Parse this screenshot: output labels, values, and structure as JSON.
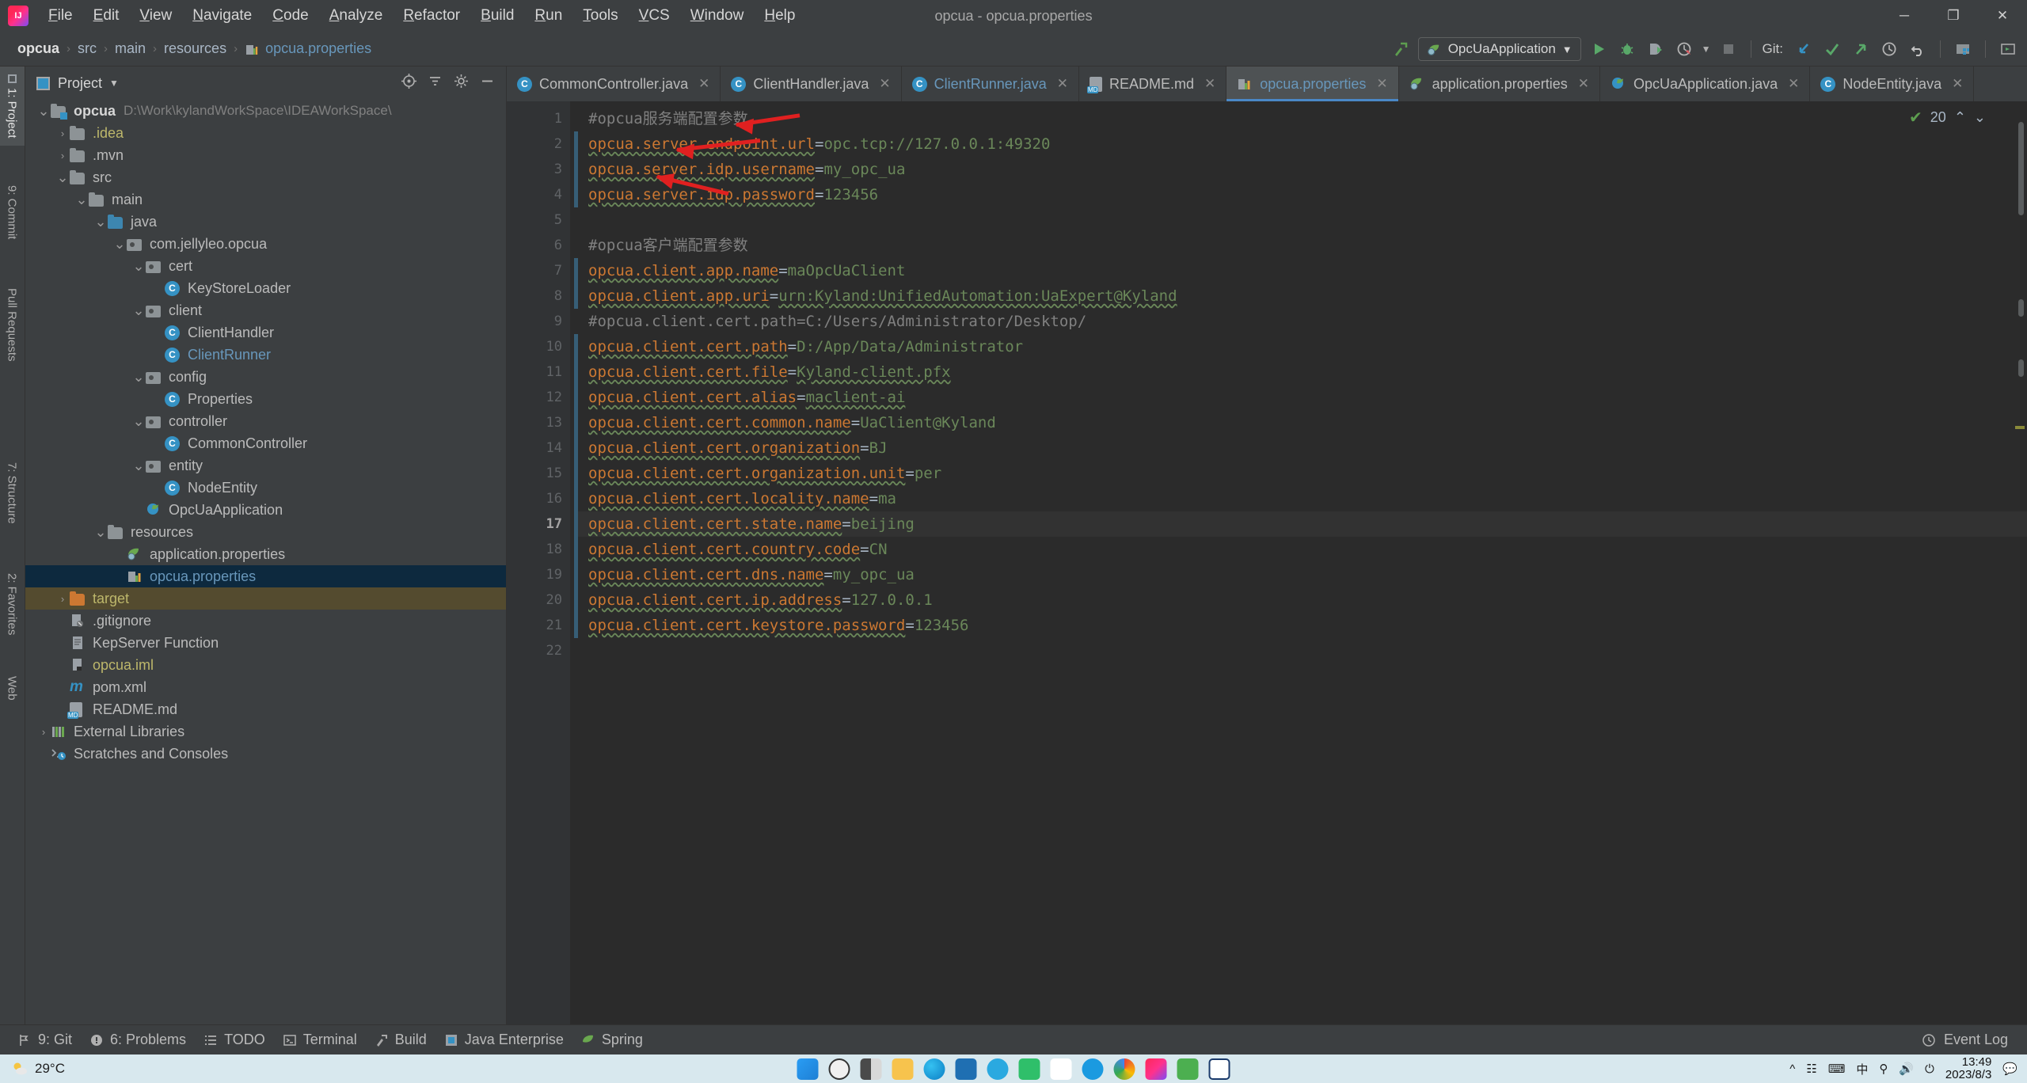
{
  "window": {
    "title": "opcua - opcua.properties",
    "minimize": "─",
    "maximize": "❐",
    "close": "✕"
  },
  "menu": [
    {
      "label": "File"
    },
    {
      "label": "Edit"
    },
    {
      "label": "View"
    },
    {
      "label": "Navigate"
    },
    {
      "label": "Code"
    },
    {
      "label": "Analyze"
    },
    {
      "label": "Refactor"
    },
    {
      "label": "Build"
    },
    {
      "label": "Run"
    },
    {
      "label": "Tools"
    },
    {
      "label": "VCS"
    },
    {
      "label": "Window"
    },
    {
      "label": "Help"
    }
  ],
  "breadcrumb": {
    "items": [
      "opcua",
      "src",
      "main",
      "resources",
      "opcua.properties"
    ],
    "separator": "›"
  },
  "toolbar": {
    "run_config": "OpcUaApplication",
    "git_label": "Git:",
    "icons": {
      "build": "hammer-icon",
      "run": "run-icon",
      "debug": "debug-icon",
      "coverage": "coverage-icon",
      "profile": "profiler-icon",
      "stop": "stop-icon",
      "update": "git-update-icon",
      "commit": "git-commit-icon",
      "push": "git-push-icon",
      "history": "history-icon",
      "rollback": "rollback-icon",
      "project-structure": "project-structure-icon",
      "search-everywhere": "terminal-icon"
    }
  },
  "left_strip": {
    "tabs": [
      {
        "label": "1: Project",
        "active": true
      },
      {
        "label": "9: Commit",
        "active": false
      },
      {
        "label": "Pull Requests",
        "active": false
      }
    ],
    "bottom_tabs": [
      {
        "label": "7: Structure"
      },
      {
        "label": "2: Favorites"
      },
      {
        "label": "Web"
      }
    ]
  },
  "project_panel": {
    "title": "Project",
    "chevron": "▾",
    "header_icons": [
      "target-icon",
      "collapse-icon",
      "settings-icon",
      "hide-icon"
    ],
    "tree": [
      {
        "indent": 0,
        "arrow": "down",
        "icon": "module-folder",
        "label": "opcua",
        "style": "bold",
        "path": "D:\\Work\\kylandWorkSpace\\IDEAWorkSpace\\"
      },
      {
        "indent": 1,
        "arrow": "right",
        "icon": "folder",
        "label": ".idea",
        "style": "yellow"
      },
      {
        "indent": 1,
        "arrow": "right",
        "icon": "folder",
        "label": ".mvn",
        "style": "plain"
      },
      {
        "indent": 1,
        "arrow": "down",
        "icon": "folder",
        "label": "src",
        "style": "plain"
      },
      {
        "indent": 2,
        "arrow": "down",
        "icon": "folder",
        "label": "main",
        "style": "plain"
      },
      {
        "indent": 3,
        "arrow": "down",
        "icon": "folder-blue",
        "label": "java",
        "style": "plain"
      },
      {
        "indent": 4,
        "arrow": "down",
        "icon": "package",
        "label": "com.jellyleo.opcua",
        "style": "plain"
      },
      {
        "indent": 5,
        "arrow": "down",
        "icon": "package",
        "label": "cert",
        "style": "plain"
      },
      {
        "indent": 6,
        "arrow": "none",
        "icon": "class",
        "label": "KeyStoreLoader",
        "style": "plain"
      },
      {
        "indent": 5,
        "arrow": "down",
        "icon": "package",
        "label": "client",
        "style": "plain"
      },
      {
        "indent": 6,
        "arrow": "none",
        "icon": "class",
        "label": "ClientHandler",
        "style": "plain"
      },
      {
        "indent": 6,
        "arrow": "none",
        "icon": "class",
        "label": "ClientRunner",
        "style": "blue"
      },
      {
        "indent": 5,
        "arrow": "down",
        "icon": "package",
        "label": "config",
        "style": "plain"
      },
      {
        "indent": 6,
        "arrow": "none",
        "icon": "class",
        "label": "Properties",
        "style": "plain"
      },
      {
        "indent": 5,
        "arrow": "down",
        "icon": "package",
        "label": "controller",
        "style": "plain"
      },
      {
        "indent": 6,
        "arrow": "none",
        "icon": "class",
        "label": "CommonController",
        "style": "plain"
      },
      {
        "indent": 5,
        "arrow": "down",
        "icon": "package",
        "label": "entity",
        "style": "plain"
      },
      {
        "indent": 6,
        "arrow": "none",
        "icon": "class",
        "label": "NodeEntity",
        "style": "plain"
      },
      {
        "indent": 5,
        "arrow": "none",
        "icon": "spring-class",
        "label": "OpcUaApplication",
        "style": "plain"
      },
      {
        "indent": 3,
        "arrow": "down",
        "icon": "resources-folder",
        "label": "resources",
        "style": "plain"
      },
      {
        "indent": 4,
        "arrow": "none",
        "icon": "spring-props",
        "label": "application.properties",
        "style": "plain"
      },
      {
        "indent": 4,
        "arrow": "none",
        "icon": "props",
        "label": "opcua.properties",
        "style": "blue",
        "selected": true
      },
      {
        "indent": 1,
        "arrow": "right",
        "icon": "folder-orange",
        "label": "target",
        "style": "yellow",
        "target": true
      },
      {
        "indent": 1,
        "arrow": "none",
        "icon": "gitignore",
        "label": ".gitignore",
        "style": "plain"
      },
      {
        "indent": 1,
        "arrow": "none",
        "icon": "text",
        "label": "KepServer Function",
        "style": "plain"
      },
      {
        "indent": 1,
        "arrow": "none",
        "icon": "iml",
        "label": "opcua.iml",
        "style": "yellow"
      },
      {
        "indent": 1,
        "arrow": "none",
        "icon": "maven",
        "label": "pom.xml",
        "style": "plain"
      },
      {
        "indent": 1,
        "arrow": "none",
        "icon": "markdown",
        "label": "README.md",
        "style": "plain"
      },
      {
        "indent": 0,
        "arrow": "right",
        "icon": "libraries",
        "label": "External Libraries",
        "style": "plain"
      },
      {
        "indent": 0,
        "arrow": "none",
        "icon": "scratches",
        "label": "Scratches and Consoles",
        "style": "plain"
      }
    ]
  },
  "editor": {
    "tabs": [
      {
        "label": "CommonController.java",
        "icon": "class",
        "active": false,
        "color": "plain"
      },
      {
        "label": "ClientHandler.java",
        "icon": "class",
        "active": false,
        "color": "plain"
      },
      {
        "label": "ClientRunner.java",
        "icon": "class",
        "active": false,
        "color": "blue"
      },
      {
        "label": "README.md",
        "icon": "markdown",
        "active": false,
        "color": "plain"
      },
      {
        "label": "opcua.properties",
        "icon": "props",
        "active": true,
        "color": "blue"
      },
      {
        "label": "application.properties",
        "icon": "spring-props",
        "active": false,
        "color": "plain"
      },
      {
        "label": "OpcUaApplication.java",
        "icon": "spring-class",
        "active": false,
        "color": "plain"
      },
      {
        "label": "NodeEntity.java",
        "icon": "class",
        "active": false,
        "color": "plain"
      }
    ],
    "close_glyph": "✕",
    "inspection": {
      "status": "✔",
      "count": "20",
      "up": "⌃",
      "down": "⌄"
    },
    "current_line": 17,
    "lines": [
      {
        "n": 1,
        "type": "comment",
        "text": "#opcua服务端配置参数"
      },
      {
        "n": 2,
        "type": "prop",
        "key": "opcua.server.endpoint.url",
        "value": "opc.tcp://127.0.0.1:49320",
        "vcs": true
      },
      {
        "n": 3,
        "type": "prop",
        "key": "opcua.server.idp.username",
        "value": "my_opc_ua",
        "vcs": true
      },
      {
        "n": 4,
        "type": "prop",
        "key": "opcua.server.idp.password",
        "value": "123456",
        "vcs": true
      },
      {
        "n": 5,
        "type": "blank",
        "text": ""
      },
      {
        "n": 6,
        "type": "comment",
        "text": "#opcua客户端配置参数"
      },
      {
        "n": 7,
        "type": "prop",
        "key": "opcua.client.app.name",
        "value": "maOpcUaClient",
        "vcs": true
      },
      {
        "n": 8,
        "type": "prop",
        "key": "opcua.client.app.uri",
        "value": "urn:Kyland:UnifiedAutomation:UaExpert@Kyland",
        "vcs": true,
        "value_sq": true
      },
      {
        "n": 9,
        "type": "comment",
        "text": "#opcua.client.cert.path=C:/Users/Administrator/Desktop/"
      },
      {
        "n": 10,
        "type": "prop",
        "key": "opcua.client.cert.path",
        "value": "D:/App/Data/Administrator",
        "vcs": true
      },
      {
        "n": 11,
        "type": "prop",
        "key": "opcua.client.cert.file",
        "value": "Kyland-client.pfx",
        "vcs": true,
        "value_sq": true
      },
      {
        "n": 12,
        "type": "prop",
        "key": "opcua.client.cert.alias",
        "value": "maclient-ai",
        "vcs": true,
        "value_sq": true
      },
      {
        "n": 13,
        "type": "prop",
        "key": "opcua.client.cert.common.name",
        "value": "UaClient@Kyland",
        "vcs": true
      },
      {
        "n": 14,
        "type": "prop",
        "key": "opcua.client.cert.organization",
        "value": "BJ",
        "vcs": true
      },
      {
        "n": 15,
        "type": "prop",
        "key": "opcua.client.cert.organization.unit",
        "value": "per",
        "vcs": true
      },
      {
        "n": 16,
        "type": "prop",
        "key": "opcua.client.cert.locality.name",
        "value": "ma",
        "vcs": true
      },
      {
        "n": 17,
        "type": "prop",
        "key": "opcua.client.cert.state.name",
        "value": "beijing",
        "vcs": true
      },
      {
        "n": 18,
        "type": "prop",
        "key": "opcua.client.cert.country.code",
        "value": "CN",
        "vcs": true
      },
      {
        "n": 19,
        "type": "prop",
        "key": "opcua.client.cert.dns.name",
        "value": "my_opc_ua",
        "vcs": true
      },
      {
        "n": 20,
        "type": "prop",
        "key": "opcua.client.cert.ip.address",
        "value": "127.0.0.1",
        "vcs": true
      },
      {
        "n": 21,
        "type": "prop",
        "key": "opcua.client.cert.keystore.password",
        "value": "123456",
        "vcs": true
      },
      {
        "n": 22,
        "type": "blank",
        "text": ""
      }
    ]
  },
  "status_bar": {
    "items": [
      {
        "label": "9: Git",
        "icon": "git-icon"
      },
      {
        "label": "6: Problems",
        "icon": "problems-icon"
      },
      {
        "label": "TODO",
        "icon": "todo-icon"
      },
      {
        "label": "Terminal",
        "icon": "terminal-icon"
      },
      {
        "label": "Build",
        "icon": "build-icon"
      },
      {
        "label": "Java Enterprise",
        "icon": "java-enterprise-icon"
      },
      {
        "label": "Spring",
        "icon": "spring-icon"
      }
    ],
    "event_log": "Event Log"
  },
  "taskbar": {
    "weather_temp": "29°C",
    "clock_time": "13:49",
    "clock_date": "2023/8/3"
  },
  "colors": {
    "accent_blue": "#4a88c7",
    "key_orange": "#cc7832",
    "value_green": "#6a8759",
    "comment_gray": "#808080",
    "selection_blue": "#0d293e",
    "target_olive": "#544b2f",
    "editor_bg": "#2b2b2b",
    "panel_bg": "#3c3f41",
    "arrow_red": "#e02020"
  }
}
